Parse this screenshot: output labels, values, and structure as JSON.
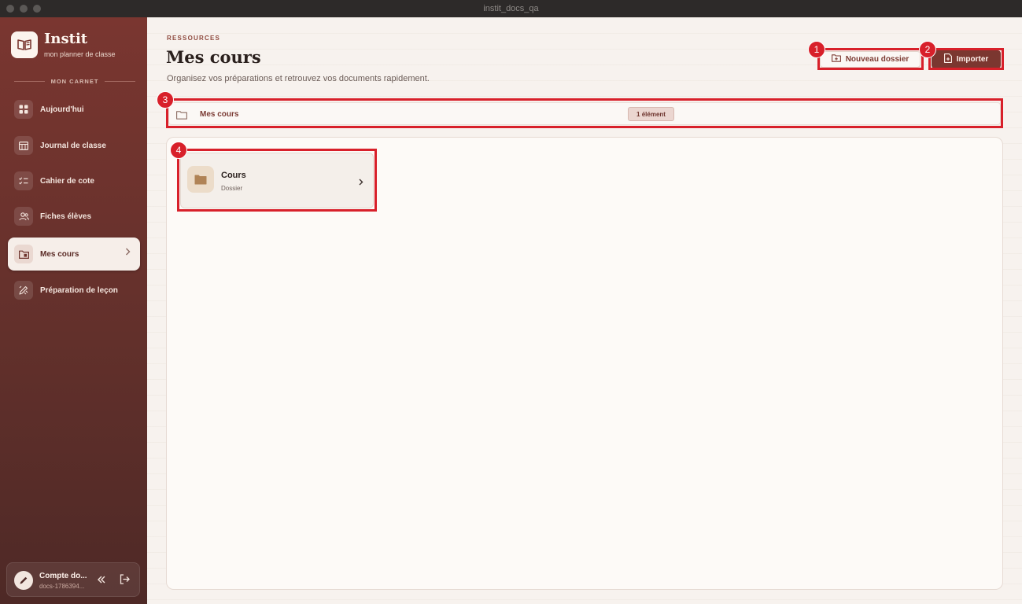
{
  "window": {
    "title": "instit_docs_qa"
  },
  "brand": {
    "name": "Instit",
    "tagline": "mon planner de classe",
    "logo_icon": "open-book-icon"
  },
  "sidebar": {
    "section_label": "MON CARNET",
    "items": [
      {
        "label": "Aujourd'hui",
        "icon": "grid-icon",
        "active": false
      },
      {
        "label": "Journal de classe",
        "icon": "table-icon",
        "active": false
      },
      {
        "label": "Cahier de cote",
        "icon": "checklist-icon",
        "active": false
      },
      {
        "label": "Fiches élèves",
        "icon": "users-icon",
        "active": false
      },
      {
        "label": "Mes cours",
        "icon": "folder-doc-icon",
        "active": true
      },
      {
        "label": "Préparation de leçon",
        "icon": "pencil-ruler-icon",
        "active": false
      }
    ],
    "account": {
      "name": "Compte do...",
      "id": "docs-1786394..."
    }
  },
  "header": {
    "eyebrow": "RESSOURCES",
    "title": "Mes cours",
    "subtitle": "Organisez vos préparations et retrouvez vos documents rapidement.",
    "new_folder_label": "Nouveau dossier",
    "import_label": "Importer"
  },
  "breadcrumb": {
    "label": "Mes cours",
    "badge": "1 élément"
  },
  "items": [
    {
      "title": "Cours",
      "subtitle": "Dossier",
      "icon": "folder-icon"
    }
  ],
  "annotations": [
    {
      "number": "1"
    },
    {
      "number": "2"
    },
    {
      "number": "3"
    },
    {
      "number": "4"
    }
  ],
  "colors": {
    "accent": "#7b3730",
    "sidebar_top": "#7a3630",
    "sidebar_bottom": "#4e2926",
    "highlight": "#d8202a"
  }
}
